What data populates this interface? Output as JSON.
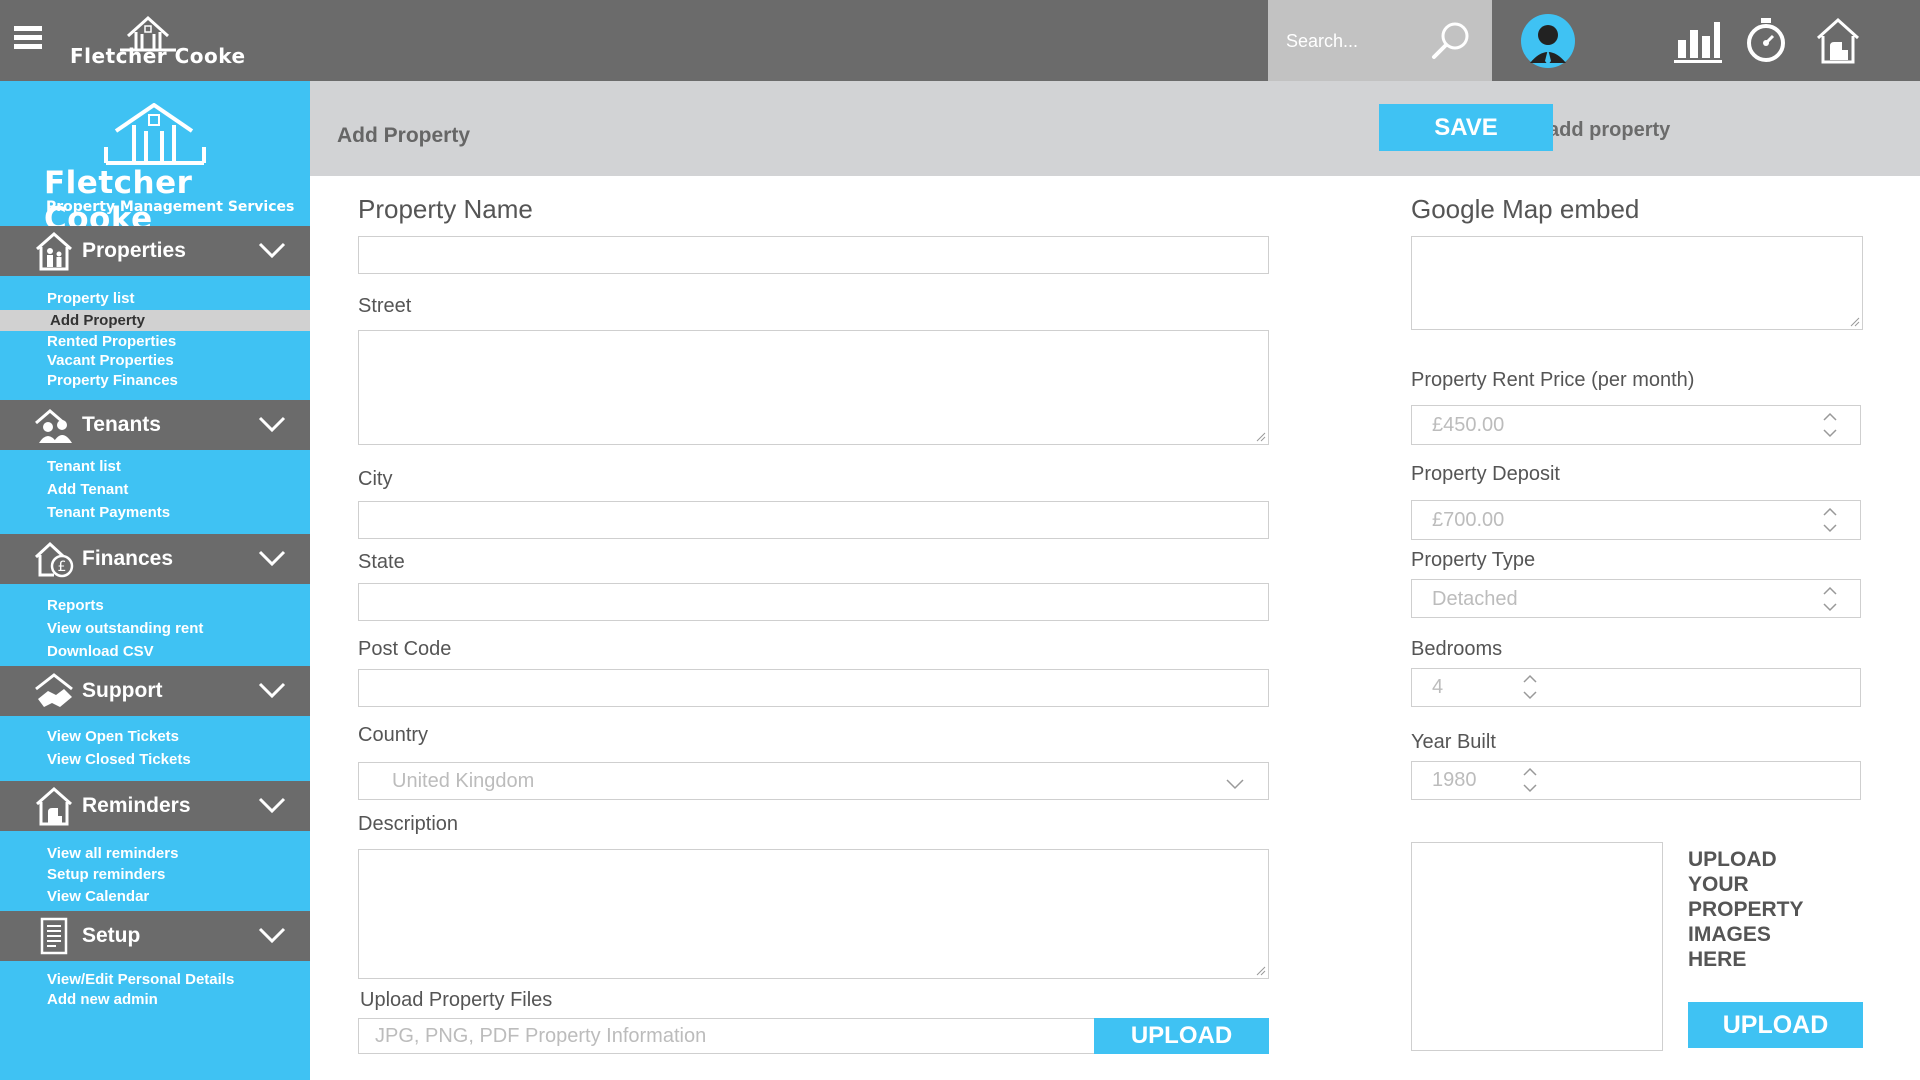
{
  "topbar": {
    "brand": "Fletcher Cooke",
    "search_placeholder": "Search..."
  },
  "sidebar": {
    "logo_title": "Fletcher Cooke",
    "logo_subtitle": "Property Management Services",
    "sections": [
      {
        "label": "Properties",
        "icon": "house-family-icon",
        "items": [
          "Property list",
          "Add Property",
          "Rented Properties",
          "Vacant Properties",
          "Property Finances"
        ]
      },
      {
        "label": "Tenants",
        "icon": "people-house-icon",
        "items": [
          "Tenant list",
          "Add Tenant",
          "Tenant Payments"
        ]
      },
      {
        "label": "Finances",
        "icon": "pound-house-icon",
        "items": [
          "Reports",
          "View outstanding rent",
          "Download CSV"
        ]
      },
      {
        "label": "Support",
        "icon": "handshake-icon",
        "items": [
          "View Open Tickets",
          "View Closed Tickets"
        ]
      },
      {
        "label": "Reminders",
        "icon": "reminder-house-icon",
        "items": [
          "View all reminders",
          "Setup reminders",
          "View Calendar"
        ]
      },
      {
        "label": "Setup",
        "icon": "document-icon",
        "items": [
          "View/Edit Personal Details",
          "Add new admin"
        ]
      }
    ],
    "active_item": "Add Property"
  },
  "header": {
    "title": "Add Property",
    "breadcrumb": "properties> add property",
    "save_label": "SAVE"
  },
  "form": {
    "property_name_label": "Property Name",
    "street_label": "Street",
    "city_label": "City",
    "state_label": "State",
    "postcode_label": "Post Code",
    "country_label": "Country",
    "country_value": "United Kingdom",
    "description_label": "Description",
    "upload_files_label": "Upload Property Files",
    "upload_files_placeholder": "JPG, PNG, PDF Property Information",
    "upload_label": "UPLOAD",
    "map_label": "Google Map embed",
    "rent_label": "Property Rent Price (per month)",
    "rent_value": "£450.00",
    "deposit_label": "Property Deposit",
    "deposit_value": "£700.00",
    "type_label": "Property Type",
    "type_value": "Detached",
    "bedrooms_label": "Bedrooms",
    "bedrooms_value": "4",
    "year_label": "Year Built",
    "year_value": "1980",
    "images_text": "UPLOAD YOUR PROPERTY IMAGES HERE",
    "images_upload_label": "UPLOAD"
  },
  "colors": {
    "accent": "#3fc2f3",
    "topbar": "#6b6b6b",
    "subheader": "#d2d3d5"
  }
}
